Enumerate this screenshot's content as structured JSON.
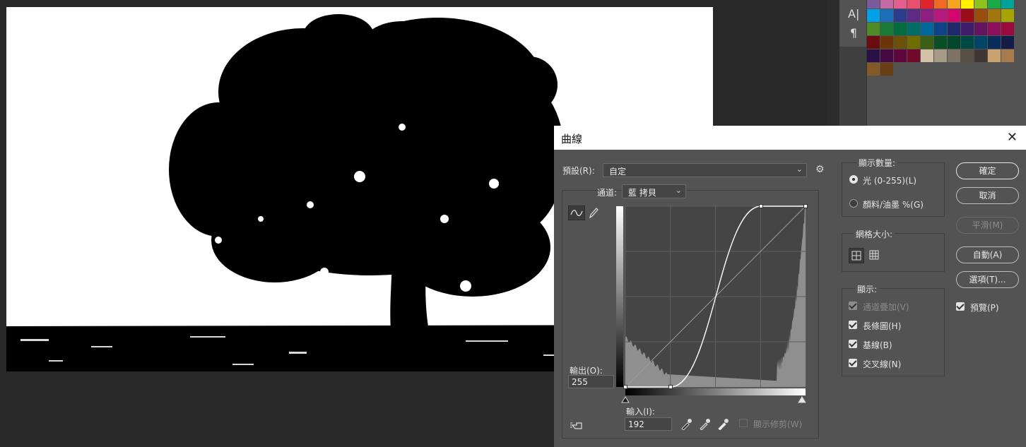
{
  "side_panel": {
    "tools": [
      {
        "glyph": "A|",
        "icon": "character-panel-icon"
      },
      {
        "glyph": "¶",
        "icon": "paragraph-panel-icon"
      }
    ],
    "swatches": [
      [
        "#7b5a9c",
        "#c46aa6",
        "#e45f8e",
        "#e94f6f",
        "#e2232c",
        "#ef6a24",
        "#f5a321",
        "#fff100",
        "#8dc21f",
        "#1ba948",
        "#00a29a"
      ],
      [
        "#00a1e9",
        "#1d6fb8",
        "#2c3d8d",
        "#5d2a86",
        "#8d1f83",
        "#b71a7d",
        "#d5076f",
        "#9c0c18",
        "#9a4d0d",
        "#a1760c",
        "#a5a400"
      ],
      [
        "#4e8a26",
        "#1c7a38",
        "#016c3e",
        "#006d66",
        "#00689c",
        "#0f4387",
        "#1e2a6c",
        "#3f1b6a",
        "#64145f",
        "#8b0f59",
        "#9b0a3f"
      ],
      [
        "#6a0c10",
        "#6d3409",
        "#6e5108",
        "#6f6d00",
        "#3c5f17",
        "#0a4f24",
        "#00482b",
        "#004844",
        "#004466",
        "#0a2c5a",
        "#141d48"
      ],
      [
        "#2b1047",
        "#440a40",
        "#5f073c",
        "#70092b",
        "#d4c2a6",
        "#a79a86",
        "#7e7363",
        "#574e45",
        "#3e3733",
        "#c9a36f",
        "#a67c4e"
      ],
      [
        "#85582a",
        "#6a3e14"
      ]
    ]
  },
  "dialog": {
    "title": "曲線",
    "preset_label": "預設(R):",
    "preset_value": "自定",
    "channel_label": "通道:",
    "channel_value": "藍 拷貝",
    "output_label": "輸出(O):",
    "output_value": "255",
    "input_label": "輸入(I):",
    "input_value": "192",
    "show_clipping_label": "顯示修剪(W)",
    "show_amount": {
      "title": "顯示數量:",
      "light": "光 (0-255)(L)",
      "pigment": "顏料/油墨 %(G)",
      "selected": "light"
    },
    "grid_size": {
      "title": "網格大小:",
      "selected": "simple"
    },
    "show": {
      "title": "顯示:",
      "items": [
        {
          "label": "通道疊加(V)",
          "checked": true,
          "disabled": true
        },
        {
          "label": "長條圖(H)",
          "checked": true,
          "disabled": false
        },
        {
          "label": "基線(B)",
          "checked": true,
          "disabled": false
        },
        {
          "label": "交叉線(N)",
          "checked": true,
          "disabled": false
        }
      ]
    },
    "buttons": {
      "ok": "確定",
      "cancel": "取消",
      "smooth": "平滑(M)",
      "auto": "自動(A)",
      "options": "選項(T)..."
    },
    "preview_label": "預覽(P)",
    "preview_checked": true,
    "curve": {
      "points": [
        [
          0,
          0
        ],
        [
          64,
          0
        ],
        [
          192,
          255
        ],
        [
          255,
          255
        ]
      ]
    }
  }
}
